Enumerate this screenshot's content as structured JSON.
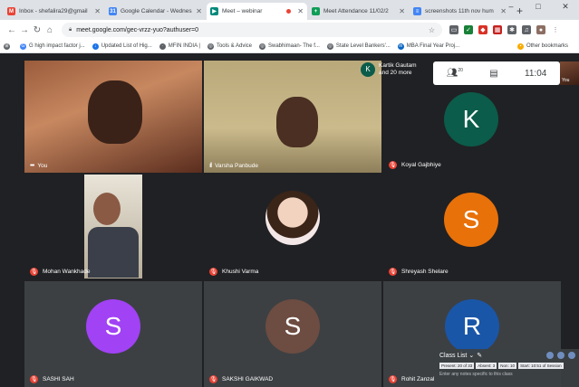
{
  "browser": {
    "tabs": [
      {
        "label": "Inbox - shefalira29@gmail",
        "icon": "gmail-icon",
        "color": "#ea4335",
        "glyph": "M",
        "active": false
      },
      {
        "label": "Google Calendar - Wednes",
        "icon": "calendar-icon",
        "color": "#4285f4",
        "glyph": "31",
        "active": false
      },
      {
        "label": "Meet – webinar",
        "icon": "meet-icon",
        "color": "#00897b",
        "glyph": "▶",
        "active": true,
        "recording": true
      },
      {
        "label": "Meet Attendance 11/02/2",
        "icon": "attendance-icon",
        "color": "#0f9d58",
        "glyph": "+",
        "active": false
      },
      {
        "label": "screenshots 11th nov hum",
        "icon": "docs-icon",
        "color": "#4285f4",
        "glyph": "≡",
        "active": false
      }
    ],
    "new_tab": "+",
    "window_controls": {
      "minimize": "–",
      "maximize": "□",
      "close": "✕"
    },
    "url": "meet.google.com/gec-vrzz-yuo?authuser=0",
    "bookmarks": [
      {
        "label": "G  high impact factor j...",
        "color": "#4285f4",
        "glyph": "G"
      },
      {
        "label": "Updated List of Hig...",
        "color": "#1a73e8",
        "glyph": "↓"
      },
      {
        "label": "MFIN INDIA |",
        "color": "#5f6368",
        "glyph": "·"
      },
      {
        "label": "Tools & Advice",
        "color": "#5f6368",
        "glyph": "◎"
      },
      {
        "label": "Swabhimaan- The f...",
        "color": "#5f6368",
        "glyph": "◎"
      },
      {
        "label": "State Level Bankers'...",
        "color": "#5f6368",
        "glyph": "◎"
      },
      {
        "label": "MBA Final Year Proj...",
        "color": "#0a66c2",
        "glyph": "in"
      }
    ],
    "other_bookmarks": "Other bookmarks"
  },
  "meet": {
    "participant_chip": {
      "initial": "K",
      "line1": "Kartik Gautam",
      "line2": "and 20 more"
    },
    "participant_count": "20",
    "clock": "11:04",
    "self_label": "You",
    "tiles": [
      {
        "name": "You",
        "type": "video",
        "mic": "on"
      },
      {
        "name": "Varsha Panbude",
        "type": "video",
        "mic": "speaking"
      },
      {
        "name": "Koyal Gajbhiye",
        "type": "avatar",
        "initial": "K",
        "color": "#0b5c4a",
        "mic": "off"
      },
      {
        "name": "Mohan Wankhade",
        "type": "video",
        "mic": "off"
      },
      {
        "name": "Khushi Varma",
        "type": "photo-avatar",
        "mic": "off"
      },
      {
        "name": "Shreyash Shelare",
        "type": "avatar",
        "initial": "S",
        "color": "#e8710a",
        "mic": "off"
      },
      {
        "name": "SASHI SAH",
        "type": "avatar",
        "initial": "S",
        "color": "#a142f4",
        "mic": "off"
      },
      {
        "name": "SAKSHI GAIKWAD",
        "type": "avatar",
        "initial": "S",
        "color": "#6d4c41",
        "mic": "off"
      },
      {
        "name": "Rohit Zanzal",
        "type": "avatar",
        "initial": "R",
        "color": "#1a56a8",
        "mic": "off"
      }
    ],
    "class_list": {
      "title": "Class List",
      "stats": [
        "Present: 20 of 33",
        "Absent: 3",
        "Non: 10",
        "Start: 10:51 of Session"
      ],
      "note": "Enter any notes specific to this class"
    }
  }
}
